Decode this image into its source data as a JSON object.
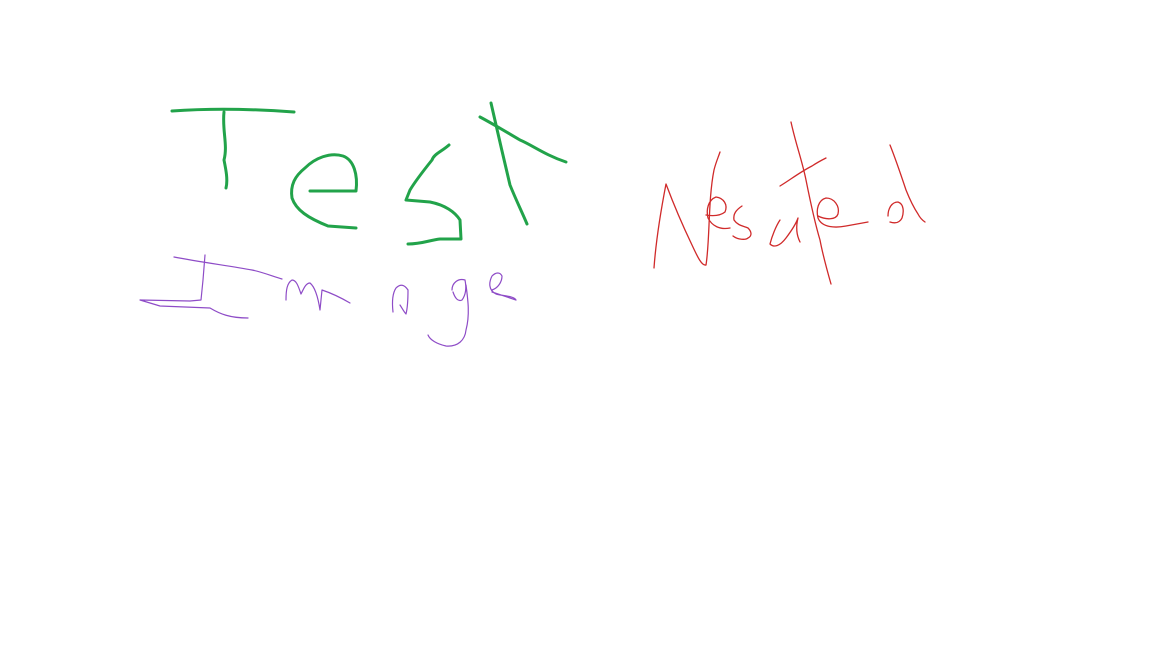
{
  "drawing": {
    "words": [
      {
        "text": "Test",
        "color": "#22a34a"
      },
      {
        "text": "Image",
        "color": "#8e4cc7"
      },
      {
        "text": "Nested",
        "color": "#d02a2a"
      }
    ]
  }
}
